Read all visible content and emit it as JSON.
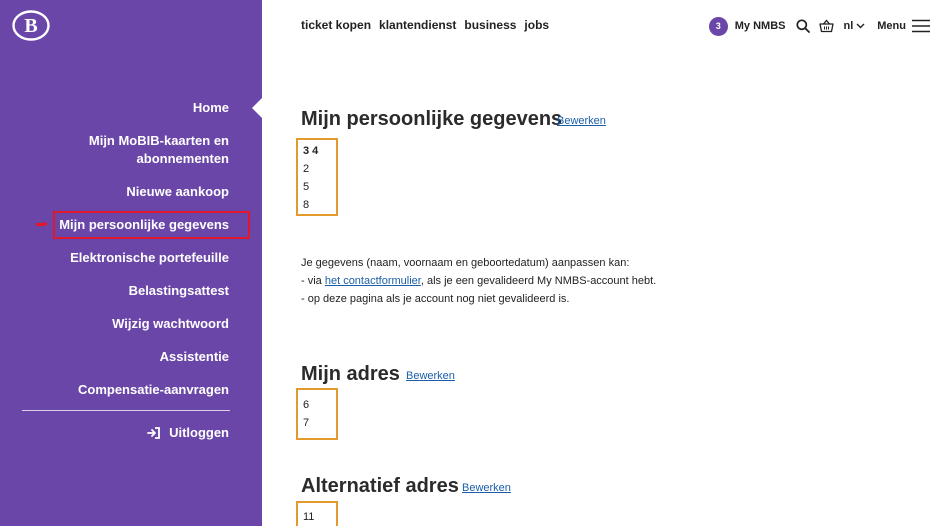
{
  "sidebar": {
    "logo_letter": "B",
    "items": [
      {
        "label": "Home"
      },
      {
        "label": "Mijn MoBIB-kaarten en"
      },
      {
        "label": "abonnementen"
      },
      {
        "label": "Nieuwe aankoop"
      },
      {
        "label": "Mijn persoonlijke gegevens"
      },
      {
        "label": "Elektronische portefeuille"
      },
      {
        "label": "Belastingsattest"
      },
      {
        "label": "Wijzig wachtwoord"
      },
      {
        "label": "Assistentie"
      },
      {
        "label": "Compensatie-aanvragen"
      }
    ],
    "logout_label": "Uitloggen"
  },
  "topnav": {
    "links": [
      "ticket kopen",
      "klantendienst",
      "business",
      "jobs"
    ]
  },
  "topright": {
    "badge_count": "3",
    "account_label": "My NMBS",
    "language": "nl",
    "menu_label": "Menu"
  },
  "main": {
    "personal": {
      "title": "Mijn persoonlijke gegevens",
      "edit_label": "Bewerken",
      "values": [
        "3 4",
        "2",
        "5",
        "8"
      ]
    },
    "info": {
      "line1": "Je gegevens (naam, voornaam en geboortedatum) aanpassen kan:",
      "line2_prefix": "- via ",
      "line2_link": "het contactformulier",
      "line2_suffix": ", als je een gevalideerd My NMBS-account hebt.",
      "line3": "- op deze pagina als je account nog niet gevalideerd is."
    },
    "address": {
      "title": "Mijn adres",
      "edit_label": "Bewerken",
      "values": [
        "6",
        "7"
      ]
    },
    "alt_address": {
      "title": "Alternatief adres",
      "edit_label": "Bewerken",
      "values": [
        "11"
      ]
    }
  },
  "colors": {
    "sidebar_bg": "#6a46a8",
    "highlight_red": "#e0182d",
    "box_orange": "#e39a2d",
    "link_blue": "#1a5fa8"
  },
  "icons": [
    "logo-icon",
    "search-icon",
    "basket-icon",
    "chevron-down-icon",
    "hamburger-menu-icon",
    "logout-icon",
    "arrow-right-icon"
  ]
}
